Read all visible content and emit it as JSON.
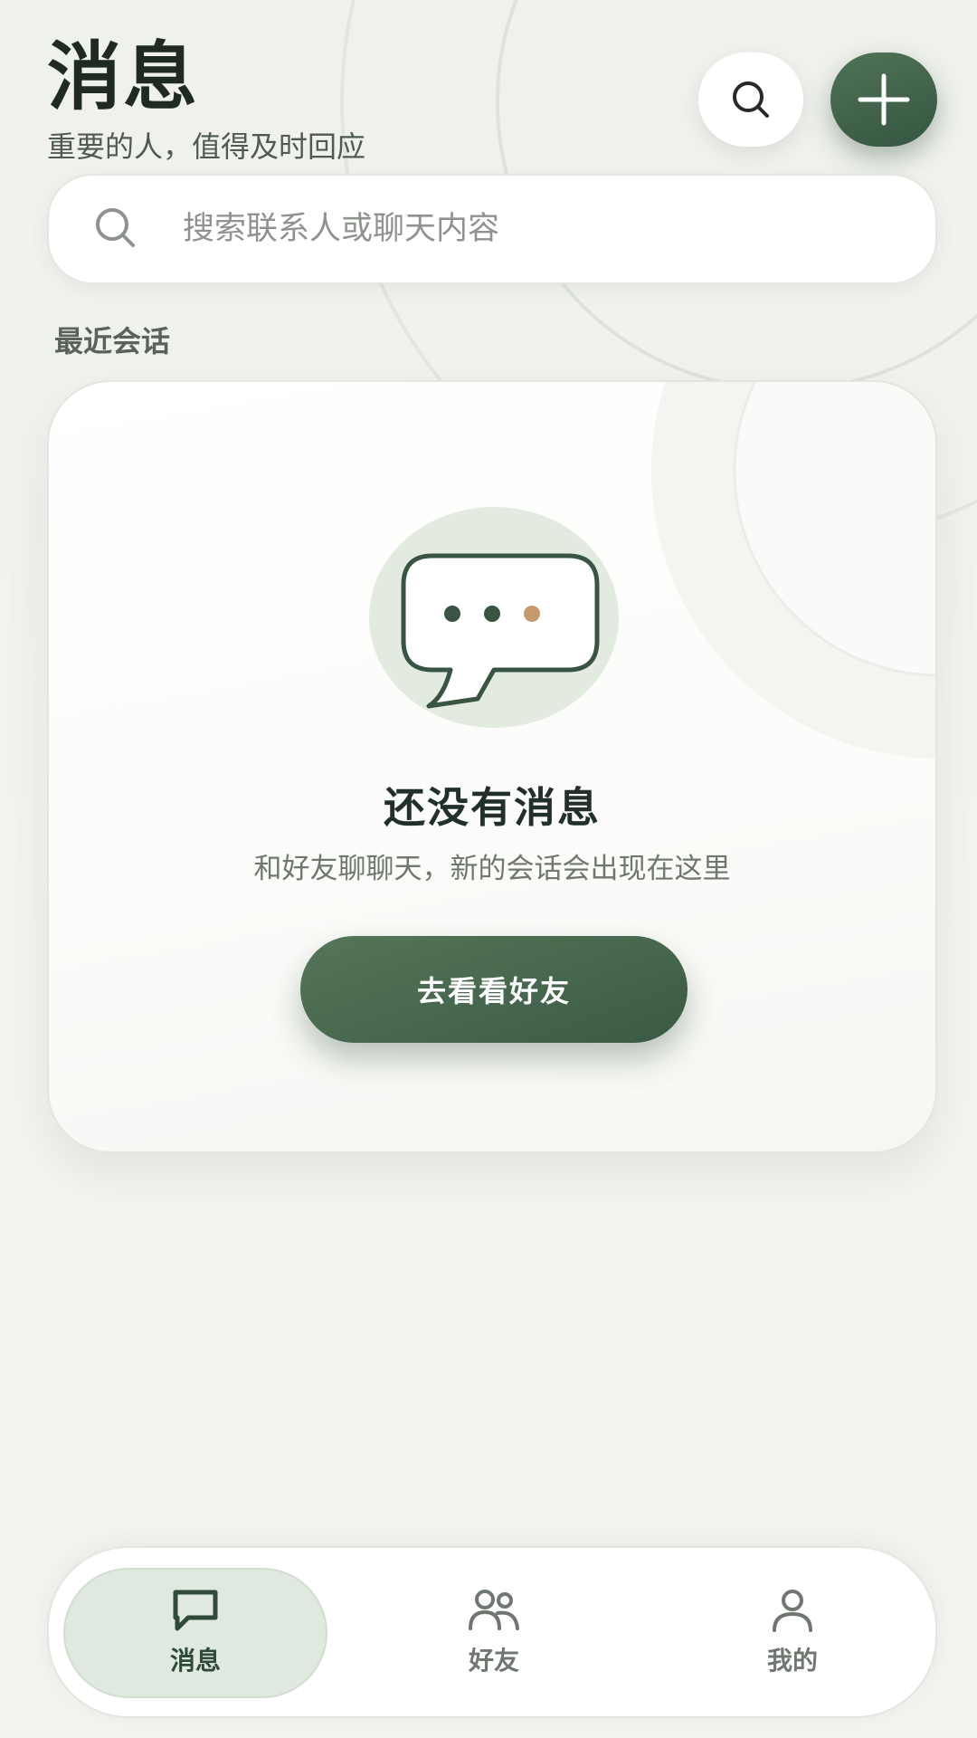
{
  "header": {
    "title": "消息",
    "subtitle": "重要的人，值得及时回应"
  },
  "actions": {
    "search_icon": "search-icon",
    "add_icon": "plus-icon"
  },
  "search": {
    "value": "",
    "placeholder": "搜索联系人或聊天内容"
  },
  "section": {
    "label": "最近会话"
  },
  "empty_state": {
    "icon": "chat-bubble-icon",
    "title": "还没有消息",
    "description": "和好友聊聊天，新的会话会出现在这里",
    "button_label": "去看看好友"
  },
  "nav": {
    "items": [
      {
        "label": "消息",
        "icon": "chat-icon",
        "active": true
      },
      {
        "label": "好友",
        "icon": "friends-icon",
        "active": false
      },
      {
        "label": "我的",
        "icon": "person-icon",
        "active": false
      }
    ]
  },
  "colors": {
    "accent": "#3f5f49",
    "accent_light": "#e0e9df",
    "dot_gold": "#c49a6c",
    "background": "#f1f2ee"
  }
}
